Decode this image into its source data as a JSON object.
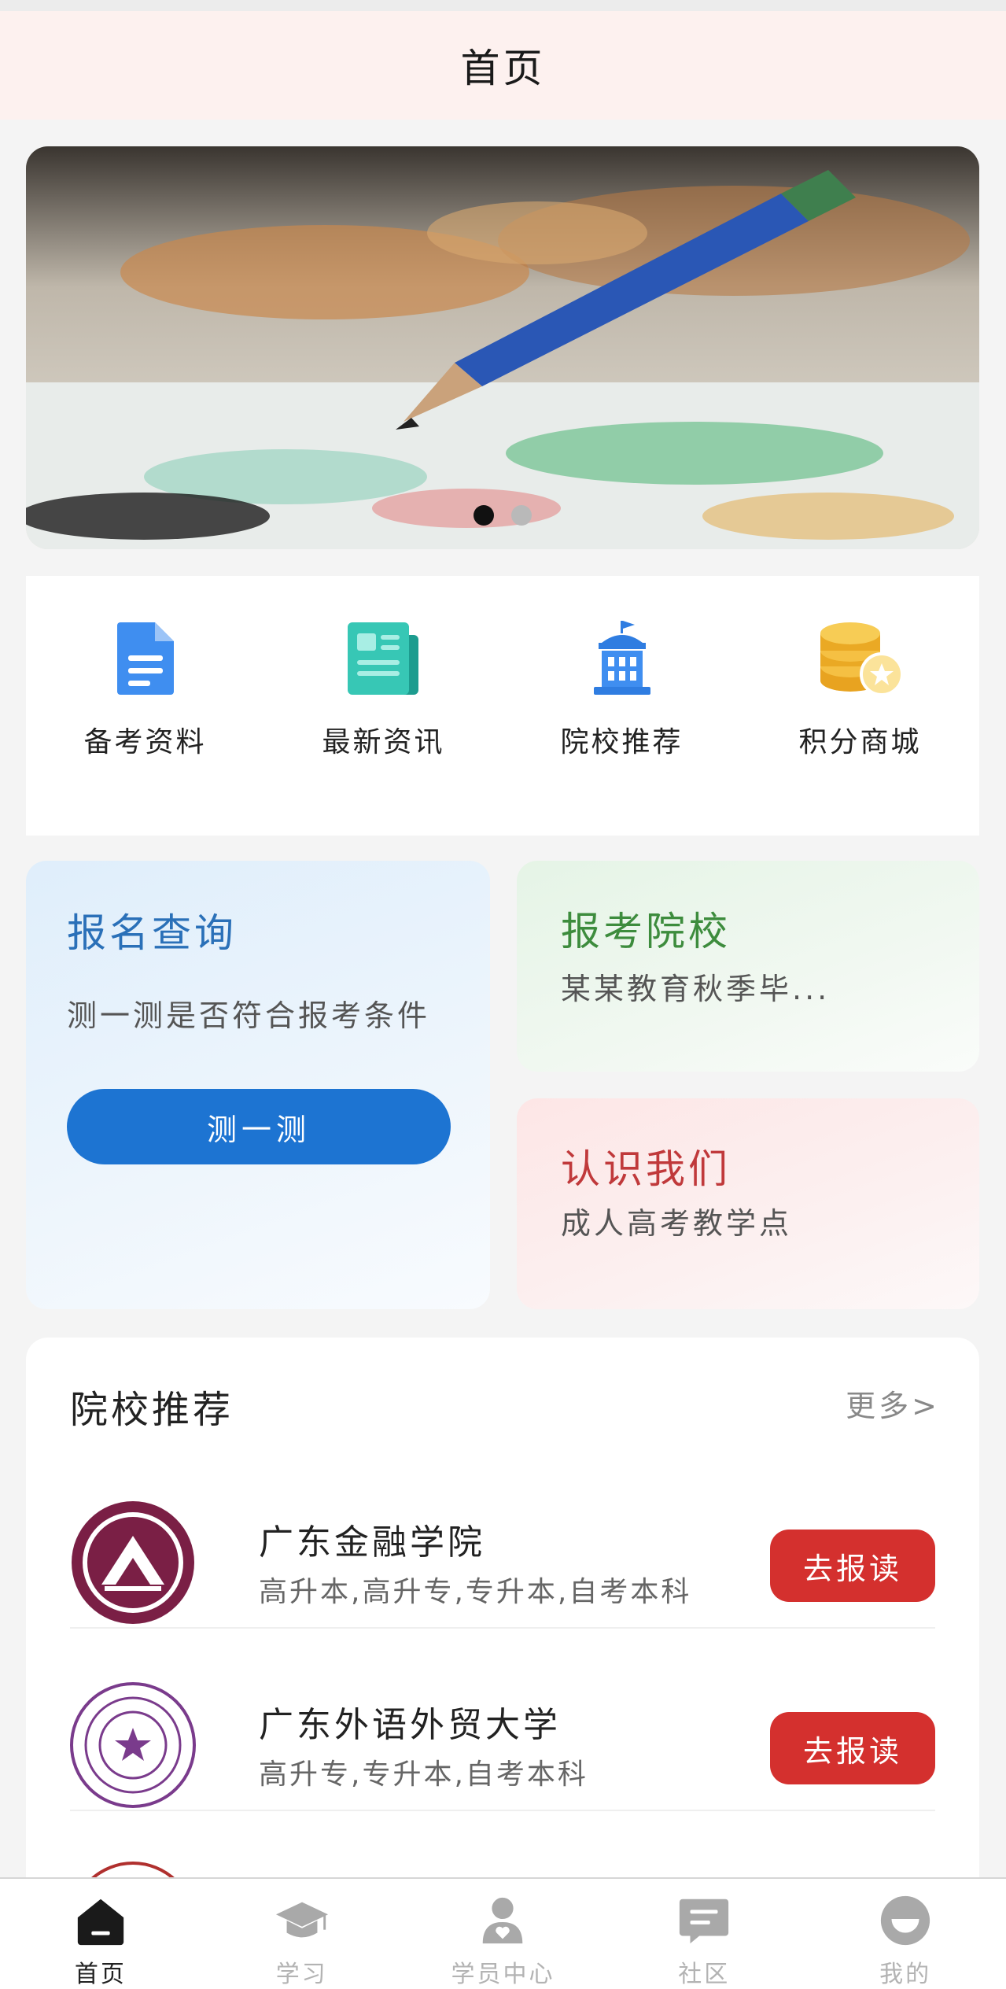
{
  "header": {
    "title": "首页"
  },
  "banner": {
    "slide_count": 2,
    "active_index": 0
  },
  "quick_links": [
    {
      "label": "备考资料",
      "icon": "document-icon"
    },
    {
      "label": "最新资讯",
      "icon": "news-icon"
    },
    {
      "label": "院校推荐",
      "icon": "school-building-icon"
    },
    {
      "label": "积分商城",
      "icon": "coins-icon"
    }
  ],
  "cards": {
    "signup": {
      "title": "报名查询",
      "desc": "测一测是否符合报考条件",
      "button": "测一测"
    },
    "school": {
      "title": "报考院校",
      "desc": "某某教育秋季毕..."
    },
    "about": {
      "title": "认识我们",
      "desc": "成人高考教学点"
    }
  },
  "recommend": {
    "title": "院校推荐",
    "more": "更多>",
    "schools": [
      {
        "name": "广东金融学院",
        "tags": "高升本,高升专,专升本,自考本科",
        "button": "去报读"
      },
      {
        "name": "广东外语外贸大学",
        "tags": "高升专,专升本,自考本科",
        "button": "去报读"
      }
    ]
  },
  "tabbar": [
    {
      "label": "首页",
      "active": true,
      "icon": "home-icon"
    },
    {
      "label": "学习",
      "active": false,
      "icon": "graduation-cap-icon"
    },
    {
      "label": "学员中心",
      "active": false,
      "icon": "user-heart-icon"
    },
    {
      "label": "社区",
      "active": false,
      "icon": "chat-icon"
    },
    {
      "label": "我的",
      "active": false,
      "icon": "profile-icon"
    }
  ],
  "colors": {
    "header_bg": "#fdf1ef",
    "primary_blue": "#1d74d2",
    "apply_red": "#d4302e",
    "school_green": "#3d8c3d",
    "about_red": "#c0393b"
  }
}
